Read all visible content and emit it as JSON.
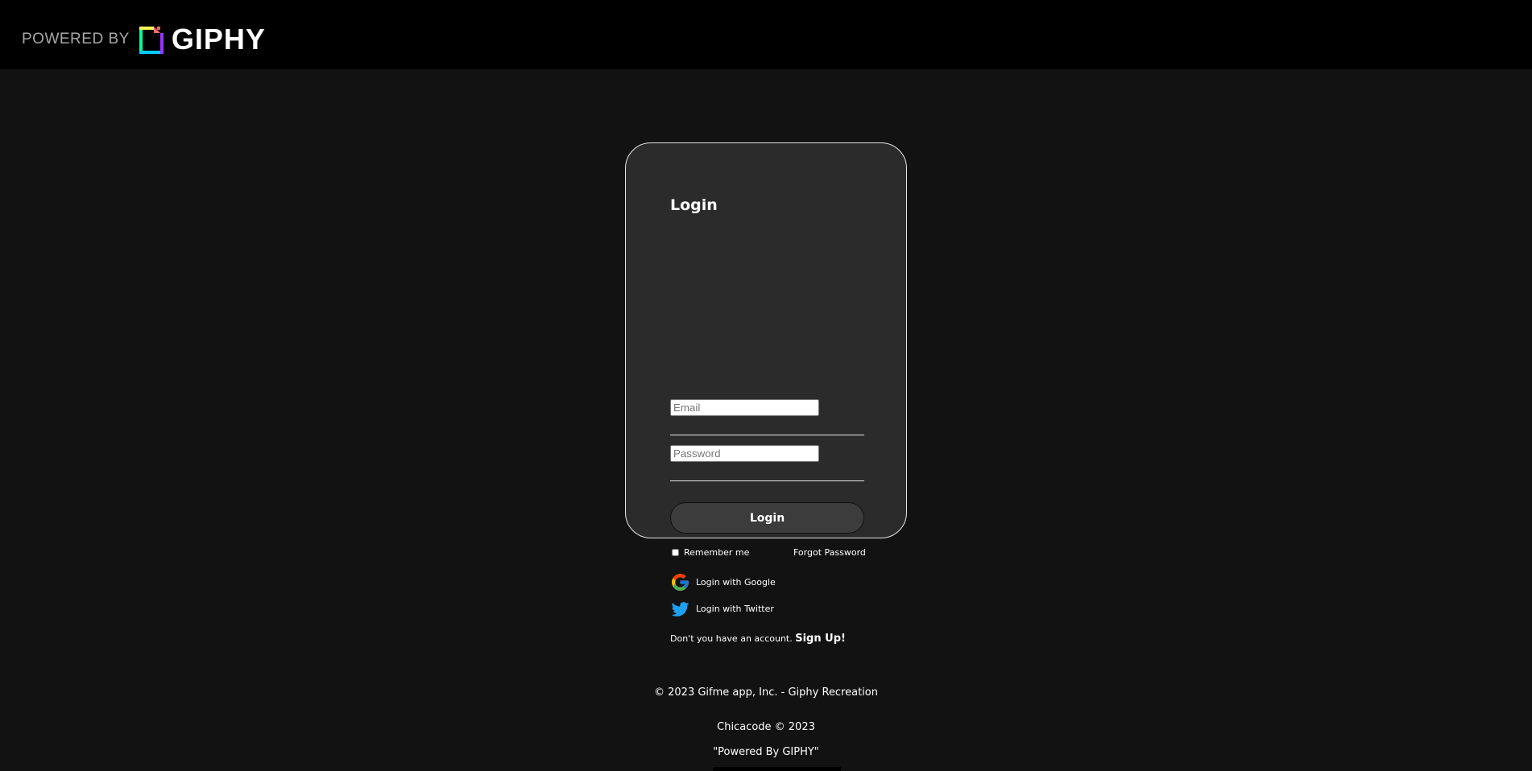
{
  "header": {
    "powered_by": "POWERED BY",
    "brand": "GIPHY",
    "logo_icon": "giphy-logo-icon"
  },
  "login_card": {
    "title": "Login",
    "email_placeholder": "Email",
    "password_placeholder": "Password",
    "login_button": "Login",
    "remember_me": "Remember me",
    "forgot_password": "Forgot Password",
    "google_label": "Login with Google",
    "twitter_label": "Login with Twitter",
    "signup_prompt": "Don't you have an account.",
    "signup_link": "Sign Up!"
  },
  "footer": {
    "copyright": "© 2023 Gifme app, Inc. - Giphy Recreation",
    "credit": "Chicacode © 2023",
    "powered": "\"Powered By GIPHY\""
  },
  "colors": {
    "page_bg": "#121212",
    "topbar_bg": "#000000",
    "card_bg": "#2b2b2b",
    "input_accent": "#8a2be2",
    "button_bg": "#3c3c3c",
    "twitter_blue": "#1da1f2"
  }
}
